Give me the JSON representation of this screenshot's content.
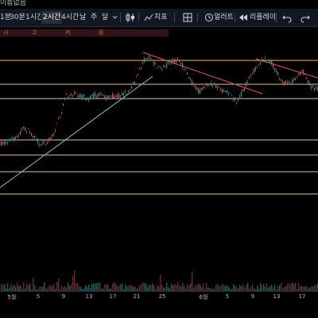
{
  "window": {
    "title": "이름없음"
  },
  "toolbar": {
    "intervals": [
      "1분",
      "30분",
      "1시간",
      "2시간",
      "4시간",
      "날",
      "주",
      "달"
    ],
    "active_interval": "2시간",
    "indicators_label": "지표",
    "alert_label": "얼러트",
    "replay_label": "리플레이"
  },
  "legend": {
    "open": "시",
    "high": "고",
    "low": "저",
    "close": "종"
  },
  "chart": {
    "colors": {
      "up": "#26a69a",
      "down": "#ef5350",
      "level_line": "#d9c4a8",
      "top_level_line": "#e8b96a",
      "support_trendline": "#7fc8b8",
      "resistance_trendline": "#e05a6a",
      "volume_up": "#1e5e57",
      "volume_down": "#6b2a2a"
    }
  },
  "x_axis": {
    "labels": [
      "5월",
      "5",
      "9",
      "13",
      "17",
      "21",
      "25",
      "6월",
      "5",
      "9",
      "13",
      "17"
    ]
  }
}
